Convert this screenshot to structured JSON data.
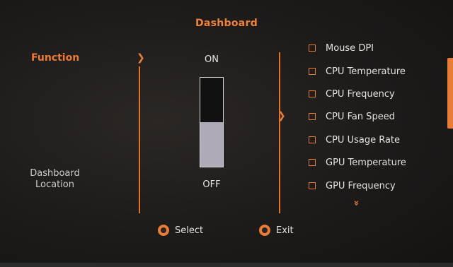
{
  "header": {
    "title": "Dashboard"
  },
  "left_menu": {
    "function_label": "Function",
    "location_line1": "Dashboard",
    "location_line2": "Location"
  },
  "toggle": {
    "on_label": "ON",
    "off_label": "OFF",
    "level": 0.5,
    "state": "ON"
  },
  "items": [
    {
      "label": "Mouse DPI",
      "checked": false
    },
    {
      "label": "CPU Temperature",
      "checked": false
    },
    {
      "label": "CPU Frequency",
      "checked": false
    },
    {
      "label": "CPU Fan Speed",
      "checked": false
    },
    {
      "label": "CPU Usage Rate",
      "checked": false
    },
    {
      "label": "GPU Temperature",
      "checked": false
    },
    {
      "label": "GPU Frequency",
      "checked": false
    }
  ],
  "more_indicator": "»",
  "footer": {
    "select_label": "Select",
    "exit_label": "Exit"
  },
  "colors": {
    "accent": "#e77d36",
    "background": "#1d1b1a",
    "text": "#e5e3e0",
    "slider_fill": "#aeaab8"
  }
}
